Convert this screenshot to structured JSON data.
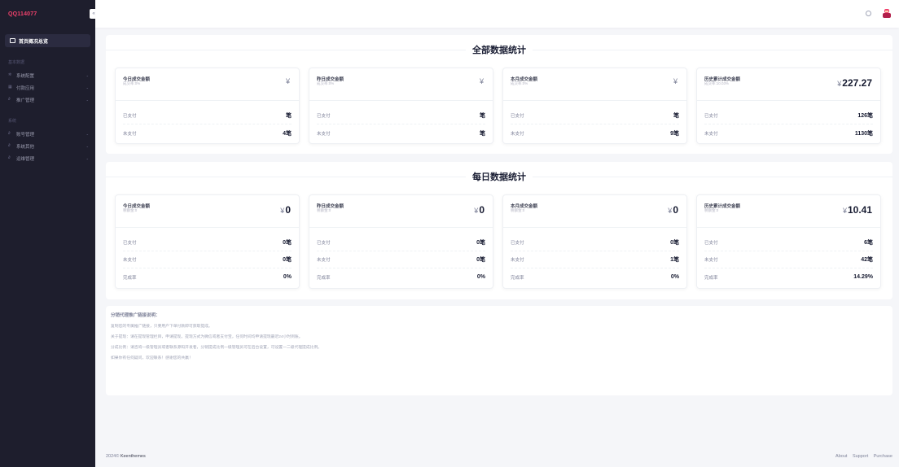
{
  "sidebar": {
    "brand": "QQ114077",
    "toggle_icon": "«",
    "active_item": "首页概况总览",
    "section1": "基本数据",
    "items1": [
      {
        "label": "系统配置",
        "icon": "gear-icon"
      },
      {
        "label": "付款应用",
        "icon": "grid-icon"
      },
      {
        "label": "推广管理",
        "icon": "link-icon"
      }
    ],
    "section2": "系统",
    "items2": [
      {
        "label": "账号管理",
        "icon": "link-icon"
      },
      {
        "label": "系统其他",
        "icon": "link-icon"
      },
      {
        "label": "运维管理",
        "icon": "link-icon"
      }
    ]
  },
  "panel1": {
    "title": "全部数据统计",
    "cards": [
      {
        "title": "今日成交金额",
        "sub": "成交率:0%",
        "currency": "¥",
        "amount": "",
        "rows": [
          {
            "k": "已支付",
            "v": "笔"
          },
          {
            "k": "未支付",
            "v": "4笔"
          }
        ]
      },
      {
        "title": "昨日成交金额",
        "sub": "成交率:0%",
        "currency": "¥",
        "amount": "",
        "rows": [
          {
            "k": "已支付",
            "v": "笔"
          },
          {
            "k": "未支付",
            "v": "笔"
          }
        ]
      },
      {
        "title": "本月成交金额",
        "sub": "成交率:0%",
        "currency": "¥",
        "amount": "",
        "rows": [
          {
            "k": "已支付",
            "v": "笔"
          },
          {
            "k": "未支付",
            "v": "9笔"
          }
        ]
      },
      {
        "title": "历史累计成交金额",
        "sub": "成交率:10.03%",
        "currency": "¥",
        "amount": "227.27",
        "rows": [
          {
            "k": "已支付",
            "v": "126笔"
          },
          {
            "k": "未支付",
            "v": "1130笔"
          }
        ]
      }
    ]
  },
  "panel2": {
    "title": "每日数据统计",
    "cards": [
      {
        "title": "今日成交金额",
        "sub": "税额金:0",
        "currency": "¥",
        "amount": "0",
        "rows": [
          {
            "k": "已支付",
            "v": "0笔"
          },
          {
            "k": "未支付",
            "v": "0笔"
          },
          {
            "k": "完成率",
            "v": "0%"
          }
        ]
      },
      {
        "title": "昨日成交金额",
        "sub": "税额金:0",
        "currency": "¥",
        "amount": "0",
        "rows": [
          {
            "k": "已支付",
            "v": "0笔"
          },
          {
            "k": "未支付",
            "v": "0笔"
          },
          {
            "k": "完成率",
            "v": "0%"
          }
        ]
      },
      {
        "title": "本月成交金额",
        "sub": "税额金:0",
        "currency": "¥",
        "amount": "0",
        "rows": [
          {
            "k": "已支付",
            "v": "0笔"
          },
          {
            "k": "未支付",
            "v": "1笔"
          },
          {
            "k": "完成率",
            "v": "0%"
          }
        ]
      },
      {
        "title": "历史累计成交金额",
        "sub": "税额金:0",
        "currency": "¥",
        "amount": "10.41",
        "rows": [
          {
            "k": "已支付",
            "v": "6笔"
          },
          {
            "k": "未支付",
            "v": "42笔"
          },
          {
            "k": "完成率",
            "v": "14.29%"
          }
        ]
      }
    ]
  },
  "notes": {
    "title": "分销代理推广链接说明：",
    "lines": [
      "复制您的专属推广链接，只要用户下单付款即可获取提成。",
      "关于提现：请在提现管理栏目，申请提现。提现方式为微信或者支付宝，任何时间均申请提现最迟24小时到账。",
      "分成比例：请咨询一级管理员或者联系源码开发者，分销提成比例一级管理员可在后台设置，可设置一二级代理提成比例。",
      "如果你有任何疑问，欢迎联系！感谢您的共赢！"
    ]
  },
  "footer": {
    "year": "2024©",
    "brand": "Keenthemes",
    "links": [
      "About",
      "Support",
      "Purchase"
    ]
  }
}
